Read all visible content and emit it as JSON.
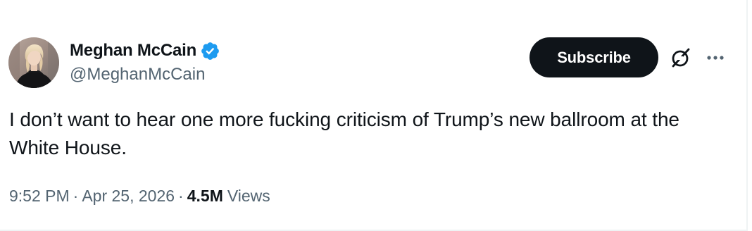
{
  "author": {
    "display_name": "Meghan McCain",
    "handle": "@MeghanMcCain",
    "verified": true
  },
  "actions": {
    "subscribe_label": "Subscribe",
    "grok_icon": "grok-icon",
    "more_icon": "more-icon"
  },
  "tweet": {
    "text": "I don’t want to hear one more fucking criticism of Trump’s new ballroom at the White House.",
    "time": "9:52 PM",
    "separator": "·",
    "date": "Apr 25, 2026",
    "views_count": "4.5M",
    "views_label": "Views"
  },
  "colors": {
    "text_primary": "#0f1419",
    "text_secondary": "#536471",
    "verified_blue": "#1d9bf0",
    "button_bg": "#0f1419",
    "background": "#ffffff"
  }
}
